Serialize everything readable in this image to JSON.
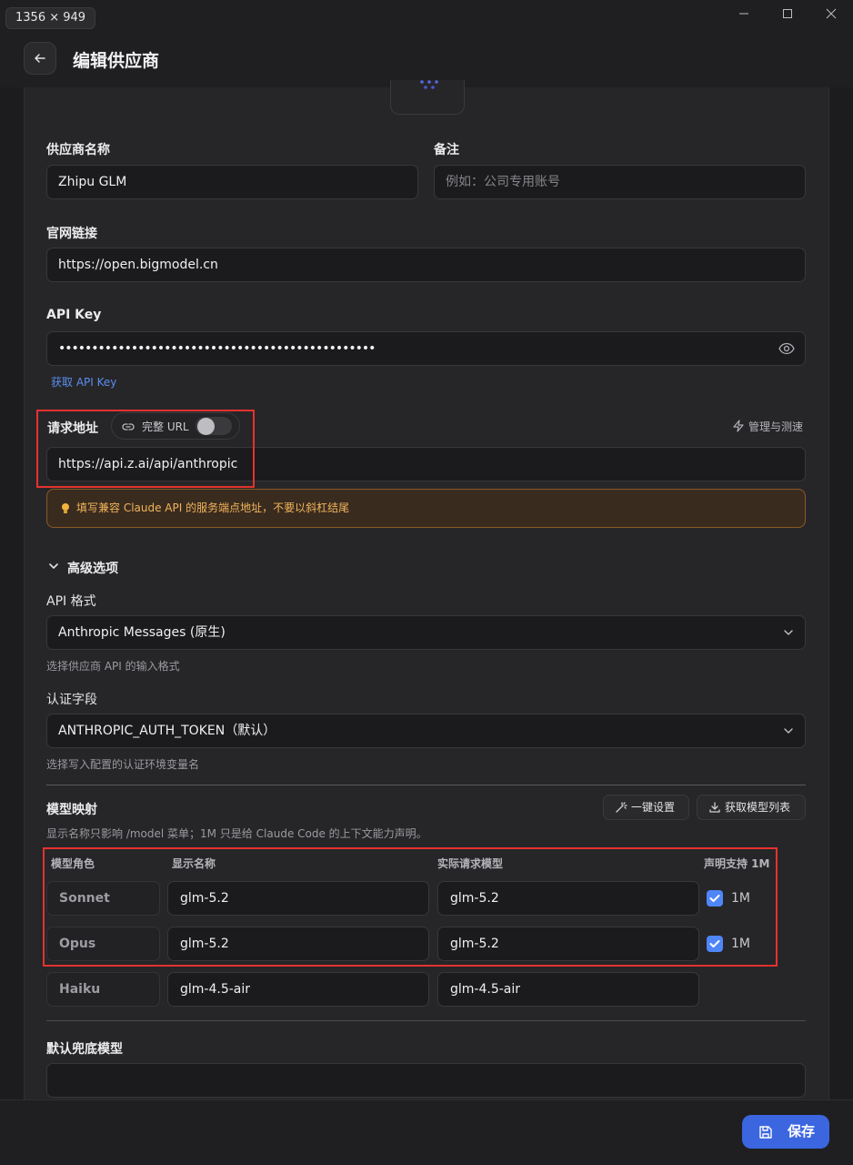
{
  "window": {
    "dimension_label": "1356 × 949"
  },
  "header": {
    "title": "编辑供应商"
  },
  "form": {
    "provider_name": {
      "label": "供应商名称",
      "value": "Zhipu GLM"
    },
    "note": {
      "label": "备注",
      "placeholder": "例如：公司专用账号"
    },
    "website": {
      "label": "官网链接",
      "value": "https://open.bigmodel.cn"
    },
    "api_key": {
      "label": "API Key",
      "value": "••••••••••••••••••••••••••••••••••••••••••••••••",
      "get_link": "获取 API Key"
    },
    "request_url": {
      "label": "请求地址",
      "full_url_toggle": "完整 URL",
      "manage_link": "管理与测速",
      "value": "https://api.z.ai/api/anthropic",
      "warning": "填写兼容 Claude API 的服务端点地址，不要以斜杠结尾"
    }
  },
  "advanced": {
    "title": "高级选项",
    "api_format": {
      "label": "API 格式",
      "value": "Anthropic Messages (原生)",
      "hint": "选择供应商 API 的输入格式"
    },
    "auth_field": {
      "label": "认证字段",
      "value": "ANTHROPIC_AUTH_TOKEN（默认）",
      "hint": "选择写入配置的认证环境变量名"
    }
  },
  "model_mapping": {
    "title": "模型映射",
    "hint": "显示名称只影响 /model 菜单；1M 只是给 Claude Code 的上下文能力声明。",
    "one_click_btn": "一键设置",
    "fetch_btn": "获取模型列表",
    "columns": [
      "模型角色",
      "显示名称",
      "实际请求模型",
      "声明支持 1M"
    ],
    "rows": [
      {
        "role": "Sonnet",
        "display": "glm-5.2",
        "actual": "glm-5.2",
        "one_m": "1M",
        "checked": true
      },
      {
        "role": "Opus",
        "display": "glm-5.2",
        "actual": "glm-5.2",
        "one_m": "1M",
        "checked": true
      },
      {
        "role": "Haiku",
        "display": "glm-4.5-air",
        "actual": "glm-4.5-air",
        "one_m": "",
        "checked": false
      }
    ]
  },
  "fallback": {
    "label": "默认兜底模型",
    "value": ""
  },
  "footer": {
    "save_label": "保存"
  },
  "colors": {
    "accent": "#3b66e0",
    "checkbox": "#4f86f7",
    "warning_text": "#f0b45a",
    "highlight_box": "#e5322e",
    "link": "#5b8def"
  }
}
